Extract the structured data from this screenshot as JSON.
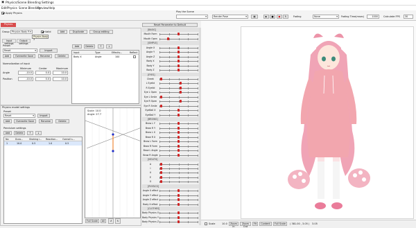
{
  "window": {
    "title": "Physics/Scene Blending Settings"
  },
  "menu": {
    "items": [
      "Edit",
      "Physics",
      "Scene Blending",
      "Preview",
      "Help"
    ]
  },
  "toolbar": {
    "apply_physics_label": "Apply Physics",
    "apply_physics_checked": true,
    "play_scene_label": "Play the Scene",
    "play_scene_value": "",
    "pose_value": "Render Pose",
    "fading_label": "Fading",
    "fading_value": "None",
    "fading_time_label": "Fading Time(msec)",
    "fading_time_value": "1000",
    "calc_fps_label": "Calculate FPS",
    "calc_fps_value": "30"
  },
  "left": {
    "tabs": [
      "Physics"
    ],
    "group_label": "Group",
    "group_value": "Physics Body R",
    "valid_label": "Valid",
    "valid_checked": true,
    "add_label": "Add",
    "duplicate_label": "Duplicate",
    "group_edit_label": "Group editing",
    "tooltip": "Physics Body 3",
    "io_tabs": [
      "Input settings",
      "Output settings"
    ],
    "preset_label": "Preset",
    "reset_label": "Reset",
    "import_label": "Import",
    "add_btn": "Add",
    "overwrite_label": "Overwrite Save",
    "rename_label": "Rename",
    "delete_label": "Delete",
    "normalization_title": "Normalization of input",
    "norm_headers": [
      "Minimum",
      "Center",
      "Maximum"
    ],
    "norm_rows": [
      {
        "label": "Angle",
        "min": "-10.0",
        "center": "0.0",
        "max": "10.0"
      },
      {
        "label": "Position",
        "min": "-10.0",
        "center": "0.0",
        "max": "10.0"
      }
    ],
    "input_toolbar": {
      "add": "Add",
      "delete": "Delete",
      "up": "↑",
      "down": "↓"
    },
    "input_grid_headers": [
      "Input",
      "Type",
      "Effectiv...",
      "Reflect"
    ],
    "input_grid_rows": [
      {
        "input": "Body X",
        "type": "Angle",
        "effect": "100",
        "reflect": false
      }
    ]
  },
  "model": {
    "title": "Physics model settings",
    "preset_label": "Preset",
    "reset_label": "Reset",
    "import_label": "Import",
    "add_btn": "Add",
    "overwrite_label": "Overwrite Save",
    "rename_label": "Rename",
    "delete_label": "Delete",
    "pendulum_label": "Pendulum settings",
    "pend_add": "Add",
    "pend_delete": "Delete",
    "pend_up": "↑",
    "pend_down": "↓",
    "pend_headers": [
      "No",
      "Dura...",
      "Shaking i...",
      "Reaction...",
      "Overall s..."
    ],
    "pend_rows": [
      {
        "no": "1",
        "dura": "10.0",
        "shake": "0.5",
        "react": "1.0",
        "overall": "0.5"
      }
    ],
    "scale_text": "Scale: 10.0",
    "angle_text": "Angle: 27.7",
    "full_scale_label": "Full Scale",
    "all_label": "All"
  },
  "params": {
    "reset_label": "Reset Parameter to Default",
    "rows": [
      {
        "label": "[BASIC]",
        "group": true
      },
      {
        "label": "Mouth Form",
        "knob": 0.5
      },
      {
        "label": "Mouth Open",
        "knob": 0.22
      },
      {
        "label": "[SIMPLE]",
        "group": true
      },
      {
        "label": "Angle X",
        "knob": 0.5
      },
      {
        "label": "Angle Y",
        "knob": 0.5
      },
      {
        "label": "Angle Z",
        "knob": 0.5
      },
      {
        "label": "Body X",
        "knob": 0.5
      },
      {
        "label": "Body Y",
        "knob": 0.5
      },
      {
        "label": "Body Z",
        "knob": 0.5
      },
      {
        "label": "[EYES]",
        "group": true
      },
      {
        "label": "Cheek",
        "knob": 0.05
      },
      {
        "label": "L Eyelid",
        "knob": 0.55
      },
      {
        "label": "R Eyelid",
        "knob": 0.55
      },
      {
        "label": "Eye L Open",
        "knob": 0.55
      },
      {
        "label": "Eye L Smile",
        "knob": 0.05
      },
      {
        "label": "Eye R Open",
        "knob": 0.55
      },
      {
        "label": "Eye R Smile",
        "knob": 0.05
      },
      {
        "label": "EyeBall X",
        "knob": 0.5
      },
      {
        "label": "EyeBall Y",
        "knob": 0.5
      },
      {
        "label": "[BROWS]",
        "group": true
      },
      {
        "label": "Brow L Y",
        "knob": 0.5
      },
      {
        "label": "Brow R Y",
        "knob": 0.5
      },
      {
        "label": "Brow L X",
        "knob": 0.5
      },
      {
        "label": "Brow R X",
        "knob": 0.5
      },
      {
        "label": "Brow L Form",
        "knob": 0.5
      },
      {
        "label": "Brow R Form",
        "knob": 0.5
      },
      {
        "label": "Brow L Angle",
        "knob": 0.5
      },
      {
        "label": "Brow R Angle",
        "knob": 0.5
      },
      {
        "label": "[MOUTH]",
        "group": true
      },
      {
        "label": "A",
        "knob": 0.05
      },
      {
        "label": "I",
        "knob": 0.05
      },
      {
        "label": "U",
        "knob": 0.05
      },
      {
        "label": "E",
        "knob": 0.05
      },
      {
        "label": "O",
        "knob": 0.05
      },
      {
        "label": "[PHYSICS]",
        "group": true
      },
      {
        "label": "Angle X effect",
        "knob": 0.5
      },
      {
        "label": "Angle Y effect",
        "knob": 0.5
      },
      {
        "label": "Angle Z effect",
        "knob": 0.5
      },
      {
        "label": "Body X effect",
        "knob": 0.5
      },
      {
        "label": "[CLOTHES]",
        "group": true
      },
      {
        "label": "Body Physics X",
        "knob": 0.5
      },
      {
        "label": "Body Physics Y",
        "knob": 0.5
      },
      {
        "label": "Body Physics Z",
        "knob": 0.5
      }
    ]
  },
  "viewer": {
    "scale_label": "Scale",
    "scale_value": "10.0",
    "zoom_in": "Zoom In",
    "zoom_out": "Zoom Out",
    "fit_label": "Fit",
    "content_label": "Content",
    "full_scale_label": "Full Scale",
    "coord_text": "( 381.00 , 3.05 )",
    "ratio_text": "3.05"
  },
  "colors": {
    "accent_red": "#d84c4c",
    "hair_pink": "#f0a4b6",
    "hoodie_pink": "#f2a6ae"
  }
}
